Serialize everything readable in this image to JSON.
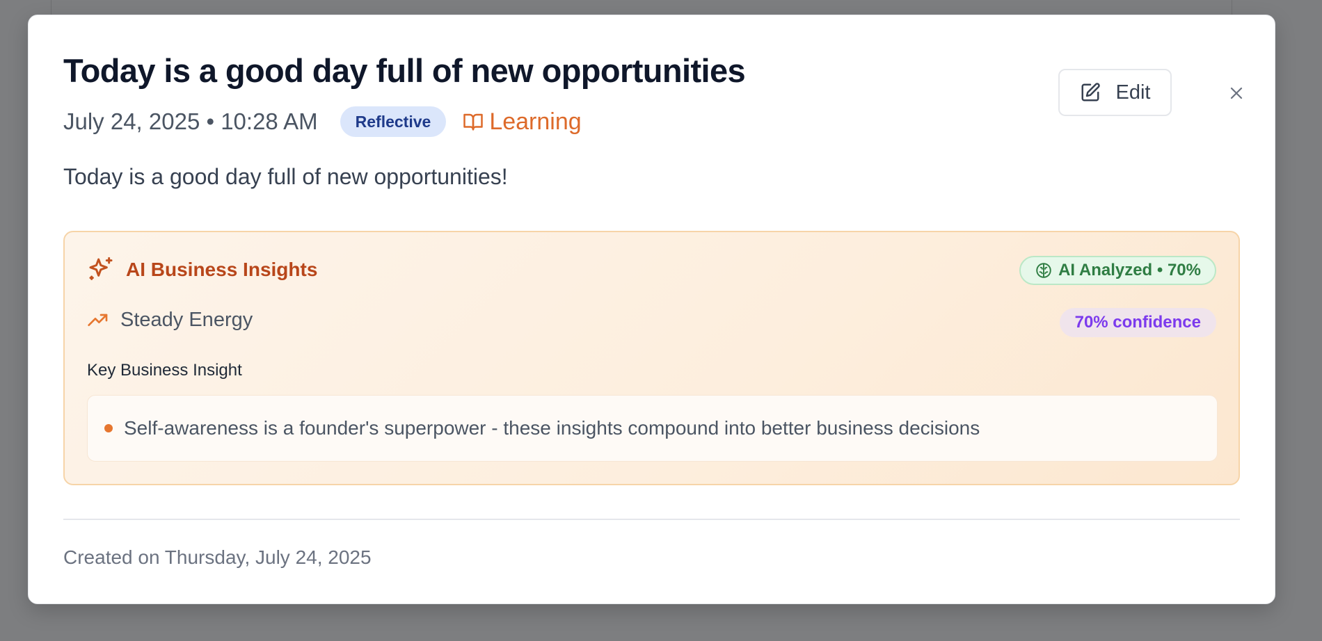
{
  "entry": {
    "title": "Today is a good day full of new opportunities",
    "date_time": "July 24, 2025 • 10:28 AM",
    "mood": "Reflective",
    "category": "Learning",
    "content": "Today is a good day full of new opportunities!",
    "created": "Created on Thursday, July 24, 2025"
  },
  "actions": {
    "edit_label": "Edit"
  },
  "insights": {
    "title": "AI Business Insights",
    "analyzed_badge": "AI Analyzed • 70%",
    "energy": "Steady Energy",
    "confidence": "70% confidence",
    "key_label": "Key Business Insight",
    "items": [
      "Self-awareness is a founder's superpower - these insights compound into better business decisions"
    ]
  },
  "icons": {
    "category": "book-open-icon",
    "edit": "edit-pencil-icon",
    "close": "close-icon",
    "insights": "sparkles-icon",
    "analyzed": "brain-icon",
    "energy": "trending-up-icon"
  },
  "colors": {
    "title": "#0f172a",
    "mood_badge_bg": "#dbe6fb",
    "mood_badge_text": "#1e3a8a",
    "category": "#dd6a2a",
    "insights_title": "#b8461a",
    "analyzed_text": "#2f7d43",
    "confidence_text": "#7c3aed",
    "bullet": "#e6762f"
  }
}
